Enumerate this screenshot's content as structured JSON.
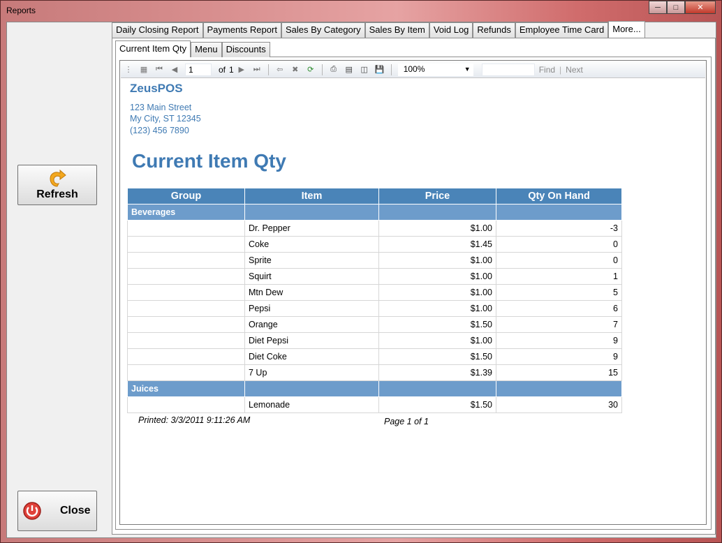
{
  "window": {
    "title": "Reports"
  },
  "side": {
    "refresh_label": "Refresh",
    "close_label": "Close"
  },
  "tabs": [
    "Daily Closing Report",
    "Payments Report",
    "Sales By Category",
    "Sales By Item",
    "Void Log",
    "Refunds",
    "Employee Time Card",
    "More..."
  ],
  "active_tab": "More...",
  "subtabs": [
    "Current Item Qty",
    "Menu",
    "Discounts"
  ],
  "active_subtab": "Current Item Qty",
  "toolbar": {
    "page_value": "1",
    "of_label": "of",
    "total_pages": "1",
    "zoom": "100%",
    "find_label": "Find",
    "separator": "|",
    "next_label": "Next"
  },
  "report": {
    "company": "ZeusPOS",
    "address1": "123 Main Street",
    "address2": "My City, ST 12345",
    "phone": "(123) 456 7890",
    "title": "Current Item Qty",
    "columns": [
      "Group",
      "Item",
      "Price",
      "Qty On Hand"
    ],
    "groups": [
      {
        "name": "Beverages",
        "rows": [
          {
            "item": "Dr. Pepper",
            "price": "$1.00",
            "qty": "-3"
          },
          {
            "item": "Coke",
            "price": "$1.45",
            "qty": "0"
          },
          {
            "item": "Sprite",
            "price": "$1.00",
            "qty": "0"
          },
          {
            "item": "Squirt",
            "price": "$1.00",
            "qty": "1"
          },
          {
            "item": "Mtn Dew",
            "price": "$1.00",
            "qty": "5"
          },
          {
            "item": "Pepsi",
            "price": "$1.00",
            "qty": "6"
          },
          {
            "item": "Orange",
            "price": "$1.50",
            "qty": "7"
          },
          {
            "item": "Diet Pepsi",
            "price": "$1.00",
            "qty": "9"
          },
          {
            "item": "Diet Coke",
            "price": "$1.50",
            "qty": "9"
          },
          {
            "item": "7 Up",
            "price": "$1.39",
            "qty": "15"
          }
        ]
      },
      {
        "name": "Juices",
        "rows": [
          {
            "item": "Lemonade",
            "price": "$1.50",
            "qty": "30"
          }
        ]
      }
    ],
    "printed": "Printed: 3/3/2011 9:11:26 AM",
    "page_footer": "Page 1  of 1"
  },
  "colors": {
    "accent": "#3f7ab3",
    "header_bg": "#4a84b8",
    "group_bg": "#6d9ccb"
  }
}
